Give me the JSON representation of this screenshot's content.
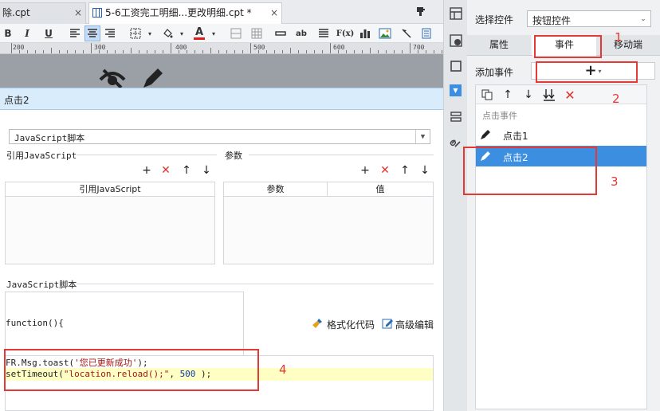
{
  "tabs": [
    {
      "label": "除.cpt",
      "close": "×"
    },
    {
      "label": "5-6工资完工明细...更改明细.cpt *",
      "close": "×"
    }
  ],
  "toolbar": {
    "bold": "B",
    "italic": "I",
    "underline": "U",
    "text_label": "ab",
    "formula": "F(x)"
  },
  "ruler": {
    "ticks": [
      "200",
      "300",
      "400",
      "500",
      "600",
      "700"
    ]
  },
  "event_header": "点击2",
  "editor": {
    "script_type": "JavaScript脚本",
    "ref_js_legend": "引用JavaScript",
    "params_legend": "参数",
    "ref_js_column": "引用JavaScript",
    "param_col_name": "参数",
    "param_col_value": "值",
    "js_legend": "JavaScript脚本",
    "function_decl": "function(){",
    "format_code": "格式化代码",
    "advanced_edit": "高级编辑",
    "code_line1_a": "FR.Msg.toast(",
    "code_line1_b": "'您已更新成功'",
    "code_line1_c": ");",
    "code_line2_a": "setTimeout(",
    "code_line2_b": "\"location.reload();\"",
    "code_line2_c": ", ",
    "code_line2_d": "500",
    "code_line2_e": " );"
  },
  "right_panel": {
    "select_label": "选择控件",
    "select_value": "按钮控件",
    "tabs": [
      "属性",
      "事件",
      "移动端"
    ],
    "add_event_label": "添加事件",
    "add_icon": "+",
    "event_group": "点击事件",
    "events": [
      "点击1",
      "点击2"
    ]
  },
  "annotations": [
    "1",
    "2",
    "3",
    "4"
  ],
  "colors": {
    "accent": "#3c8fe0",
    "annotation": "#e53935",
    "highlight": "#ffffc4",
    "header": "#d9ecfb"
  }
}
